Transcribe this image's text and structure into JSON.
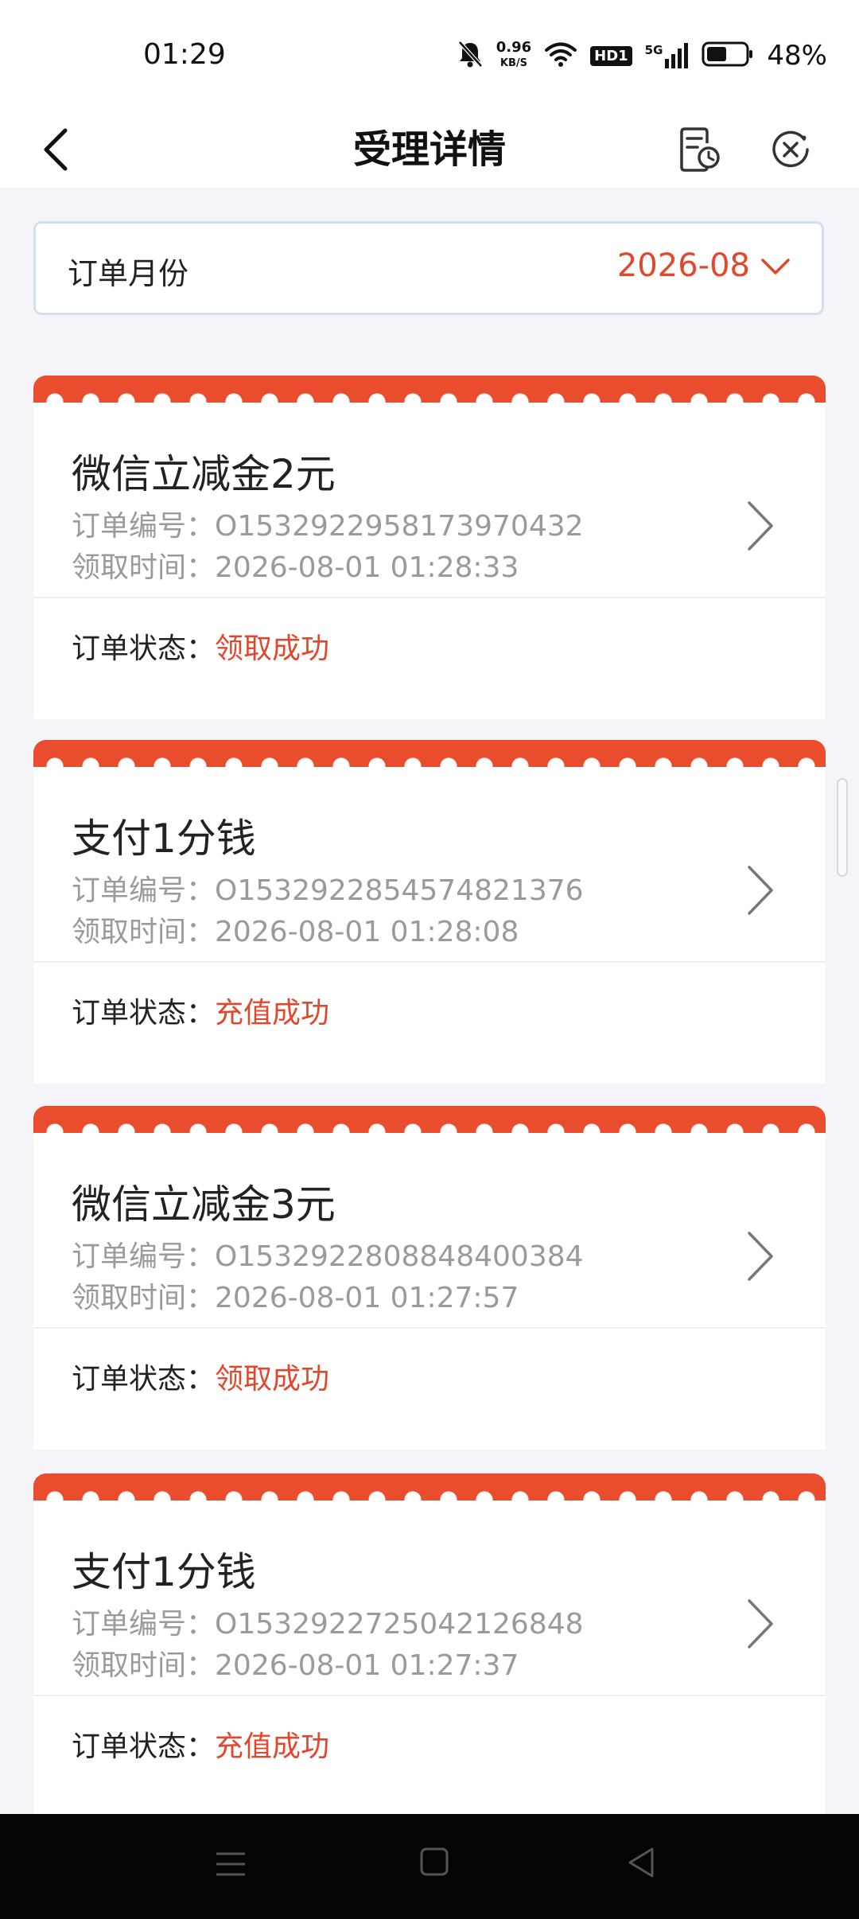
{
  "status_bar": {
    "time": "01:29",
    "net_speed_value": "0.96",
    "net_speed_unit": "KB/S",
    "hd_label": "HD1",
    "signal_label": "5G",
    "battery_percent": "48%",
    "icons": [
      "bell-muted-icon",
      "wifi-icon",
      "hd-icon",
      "5g-signal-icon",
      "battery-icon"
    ]
  },
  "header": {
    "title": "受理详情",
    "icons": [
      "back-icon",
      "history-icon",
      "close-icon"
    ]
  },
  "filter": {
    "label": "订单月份",
    "value": "2026-08"
  },
  "orders": [
    {
      "title": "微信立减金2元",
      "order_label": "订单编号：",
      "order_no": "O1532922958173970432",
      "time_label": "领取时间：",
      "time": "2026-08-01 01:28:33",
      "status_label": "订单状态：",
      "status": "领取成功"
    },
    {
      "title": "支付1分钱",
      "order_label": "订单编号：",
      "order_no": "O1532922854574821376",
      "time_label": "领取时间：",
      "time": "2026-08-01 01:28:08",
      "status_label": "订单状态：",
      "status": "充值成功"
    },
    {
      "title": "微信立减金3元",
      "order_label": "订单编号：",
      "order_no": "O1532922808848400384",
      "time_label": "领取时间：",
      "time": "2026-08-01 01:27:57",
      "status_label": "订单状态：",
      "status": "领取成功"
    },
    {
      "title": "支付1分钱",
      "order_label": "订单编号：",
      "order_no": "O1532922725042126848",
      "time_label": "领取时间：",
      "time": "2026-08-01 01:27:37",
      "status_label": "订单状态：",
      "status": "充值成功"
    }
  ],
  "colors": {
    "accent": "#e2472c",
    "card_header": "#ea4d2e",
    "page_background": "#f4f4f9"
  }
}
